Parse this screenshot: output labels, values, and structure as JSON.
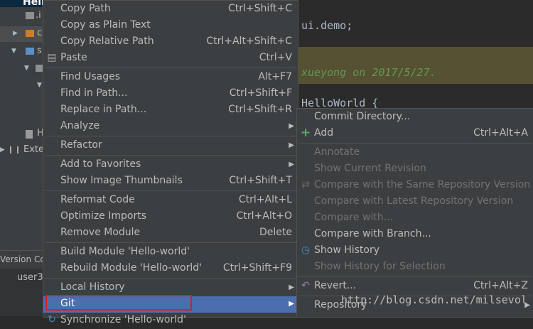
{
  "project": {
    "title": "Hell",
    "tree": [
      {
        "label": ".i",
        "color": "#aaaaaa"
      },
      {
        "label": "c",
        "color": "#c77d33"
      },
      {
        "label": "s",
        "color": "#5c90c7"
      },
      {
        "label": "",
        "color": "#aaaaaa"
      },
      {
        "label": "",
        "color": ""
      },
      {
        "label": "H",
        "color": "#aaaaaa"
      },
      {
        "label": "Exte",
        "color": "#aaaaaa"
      }
    ],
    "version_control": "Version Co",
    "user": "user3"
  },
  "editor": {
    "code_line1": "ui.demo;",
    "code_line2": "xueyong on 2017/5/27.",
    "code_line3": "HelloWorld {",
    "watermark": "http://blog.csdn.net/milsevol"
  },
  "main_menu": {
    "items": [
      {
        "label": "Copy Path",
        "shortcut": "Ctrl+Shift+C"
      },
      {
        "label": "Copy as Plain Text",
        "shortcut": ""
      },
      {
        "label": "Copy Relative Path",
        "shortcut": "Ctrl+Alt+Shift+C"
      },
      {
        "label": "Paste",
        "shortcut": "Ctrl+V"
      },
      {
        "label": "Find Usages",
        "shortcut": "Alt+F7"
      },
      {
        "label": "Find in Path...",
        "shortcut": "Ctrl+Shift+F"
      },
      {
        "label": "Replace in Path...",
        "shortcut": "Ctrl+Shift+R"
      },
      {
        "label": "Analyze",
        "shortcut": ""
      },
      {
        "label": "Refactor",
        "shortcut": ""
      },
      {
        "label": "Add to Favorites",
        "shortcut": ""
      },
      {
        "label": "Show Image Thumbnails",
        "shortcut": "Ctrl+Shift+T"
      },
      {
        "label": "Reformat Code",
        "shortcut": "Ctrl+Alt+L"
      },
      {
        "label": "Optimize Imports",
        "shortcut": "Ctrl+Alt+O"
      },
      {
        "label": "Remove Module",
        "shortcut": "Delete"
      },
      {
        "label": "Build Module 'Hello-world'",
        "shortcut": ""
      },
      {
        "label": "Rebuild Module 'Hello-world'",
        "shortcut": "Ctrl+Shift+F9"
      },
      {
        "label": "Local History",
        "shortcut": ""
      },
      {
        "label": "Git",
        "shortcut": ""
      },
      {
        "label": "Synchronize 'Hello-world'",
        "shortcut": ""
      }
    ]
  },
  "git_menu": {
    "items": [
      {
        "label": "Commit Directory...",
        "shortcut": ""
      },
      {
        "label": "Add",
        "shortcut": "Ctrl+Alt+A"
      },
      {
        "label": "Annotate",
        "shortcut": ""
      },
      {
        "label": "Show Current Revision",
        "shortcut": ""
      },
      {
        "label": "Compare with the Same Repository Version",
        "shortcut": ""
      },
      {
        "label": "Compare with Latest Repository Version",
        "shortcut": ""
      },
      {
        "label": "Compare with...",
        "shortcut": ""
      },
      {
        "label": "Compare with Branch...",
        "shortcut": ""
      },
      {
        "label": "Show History",
        "shortcut": ""
      },
      {
        "label": "Show History for Selection",
        "shortcut": ""
      },
      {
        "label": "Revert...",
        "shortcut": "Ctrl+Alt+Z"
      },
      {
        "label": "Repository",
        "shortcut": ""
      }
    ]
  },
  "colors": {
    "menu_bg": "#3c3f41",
    "selection": "#4b6eaf",
    "highlight_box": "#e01b1b",
    "add_icon": "#59a869",
    "history_icon": "#3d8fd1",
    "revert_icon": "#9876aa"
  }
}
